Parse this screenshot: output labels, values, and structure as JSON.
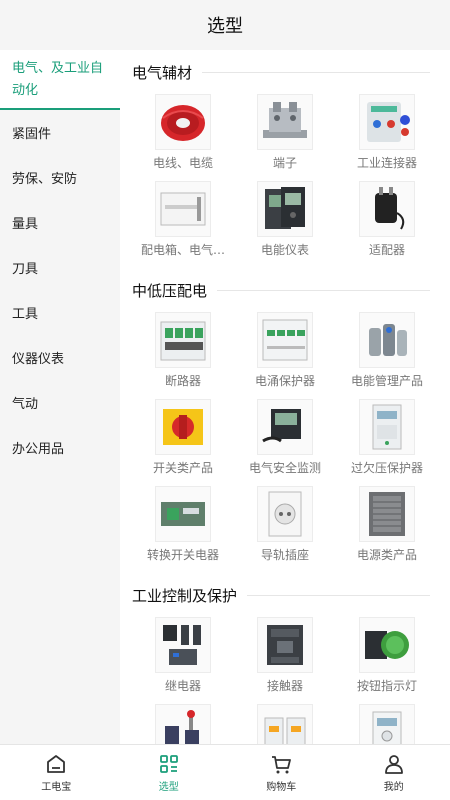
{
  "header": {
    "title": "选型"
  },
  "sidebar": {
    "items": [
      {
        "label": "电气、及工业自动化"
      },
      {
        "label": "紧固件"
      },
      {
        "label": "劳保、安防"
      },
      {
        "label": "量具"
      },
      {
        "label": "刀具"
      },
      {
        "label": "工具"
      },
      {
        "label": "仪器仪表"
      },
      {
        "label": "气动"
      },
      {
        "label": "办公用品"
      }
    ]
  },
  "sections": [
    {
      "title": "电气辅材",
      "items": [
        {
          "label": "电线、电缆",
          "icon": "red-cable-icon"
        },
        {
          "label": "端子",
          "icon": "terminal-block-icon"
        },
        {
          "label": "工业连接器",
          "icon": "industrial-connector-icon"
        },
        {
          "label": "配电箱、电气…",
          "icon": "distribution-box-icon"
        },
        {
          "label": "电能仪表",
          "icon": "energy-meter-icon"
        },
        {
          "label": "适配器",
          "icon": "adapter-icon"
        }
      ]
    },
    {
      "title": "中低压配电",
      "items": [
        {
          "label": "断路器",
          "icon": "circuit-breaker-icon"
        },
        {
          "label": "电涌保护器",
          "icon": "surge-protector-icon"
        },
        {
          "label": "电能管理产品",
          "icon": "energy-management-icon"
        },
        {
          "label": "开关类产品",
          "icon": "switch-icon"
        },
        {
          "label": "电气安全监测",
          "icon": "safety-monitor-icon"
        },
        {
          "label": "过欠压保护器",
          "icon": "voltage-protector-icon"
        },
        {
          "label": "转换开关电器",
          "icon": "transfer-switch-icon"
        },
        {
          "label": "导轨插座",
          "icon": "rail-socket-icon"
        },
        {
          "label": "电源类产品",
          "icon": "power-supply-icon"
        }
      ]
    },
    {
      "title": "工业控制及保护",
      "items": [
        {
          "label": "继电器",
          "icon": "relay-icon"
        },
        {
          "label": "接触器",
          "icon": "contactor-icon"
        },
        {
          "label": "按钮指示灯",
          "icon": "push-button-icon"
        },
        {
          "label": "",
          "icon": "limit-switch-icon"
        },
        {
          "label": "",
          "icon": "motor-starter-icon"
        },
        {
          "label": "",
          "icon": "timer-relay-icon"
        }
      ]
    }
  ],
  "tabbar": {
    "tabs": [
      {
        "label": "工电宝",
        "icon": "home-icon"
      },
      {
        "label": "选型",
        "icon": "grid-icon"
      },
      {
        "label": "购物车",
        "icon": "cart-icon"
      },
      {
        "label": "我的",
        "icon": "user-icon"
      }
    ],
    "active_color": "#1a9e7a"
  }
}
